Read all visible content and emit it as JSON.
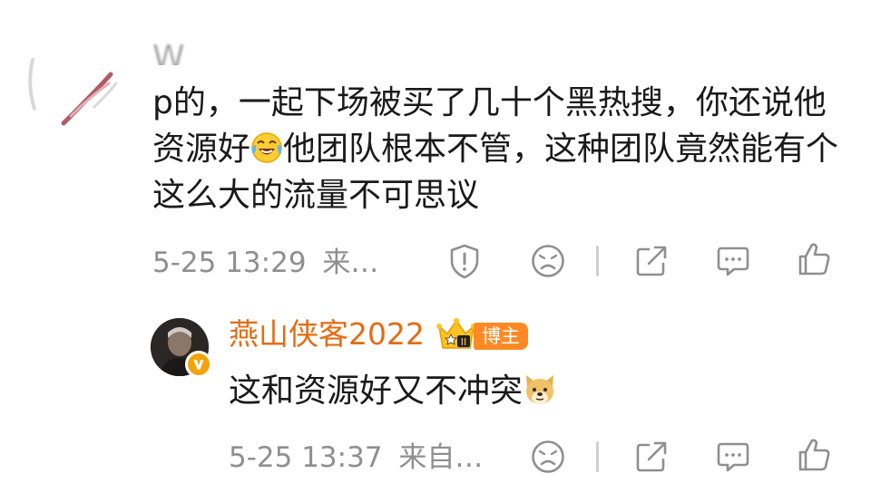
{
  "comment": {
    "truncated_top_line": "W",
    "text_part1": "p的，一起下场被买了几十个黑热搜，你还说他资源好",
    "emoji1": "laughing-crying-emoji",
    "text_part2": "他团队根本不管，这种团队竟然能有个这么大的流量不可思议",
    "time": "5-25 13:29",
    "source": "来…",
    "actions": [
      "report-icon",
      "dislike-icon",
      "share-icon",
      "reply-icon",
      "like-icon"
    ]
  },
  "reply": {
    "username": "燕山侠客2022",
    "badge_level": "II",
    "tag": "博主",
    "text": "这和资源好又不冲突",
    "emoji": "doge-emoji",
    "time": "5-25 13:37",
    "source": "来自…",
    "actions": [
      "dislike-icon",
      "share-icon",
      "reply-icon",
      "like-icon"
    ]
  },
  "colors": {
    "username": "#e46c12",
    "tag_bg": "#ff8a25",
    "meta": "#8f8f8f",
    "text": "#1a1a1a"
  }
}
